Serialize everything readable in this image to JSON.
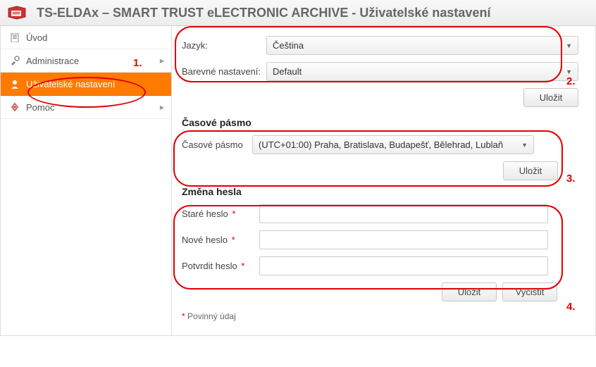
{
  "header": {
    "title": "TS-ELDAx – SMART TRUST eLECTRONIC ARCHIVE - Uživatelské nastavení"
  },
  "sidebar": {
    "items": [
      {
        "label": "Úvod",
        "icon": "home",
        "expandable": false
      },
      {
        "label": "Administrace",
        "icon": "tools",
        "expandable": true
      },
      {
        "label": "Uživatelské nastavení",
        "icon": "user",
        "expandable": false,
        "active": true
      },
      {
        "label": "Pomoc",
        "icon": "help",
        "expandable": true
      }
    ]
  },
  "form": {
    "language": {
      "label": "Jazyk:",
      "value": "Čeština"
    },
    "colorTheme": {
      "label": "Barevné nastavení:",
      "value": "Default"
    },
    "saveBtn1": "Uložit",
    "tzHeading": "Časové pásmo",
    "timezone": {
      "label": "Časové pásmo",
      "value": "(UTC+01:00) Praha, Bratislava, Budapešť, Bělehrad, Lublaň"
    },
    "saveBtn2": "Uložit",
    "pwHeading": "Změna hesla",
    "oldPw": {
      "label": "Staré heslo"
    },
    "newPw": {
      "label": "Nové heslo"
    },
    "confirmPw": {
      "label": "Potvrdit heslo"
    },
    "saveBtn3": "Uložit",
    "clearBtn": "Vyčistit",
    "requiredStar": "*",
    "requiredText": "Povinný údaj"
  },
  "annotations": {
    "n1": "1.",
    "n2": "2.",
    "n3": "3.",
    "n4": "4."
  }
}
